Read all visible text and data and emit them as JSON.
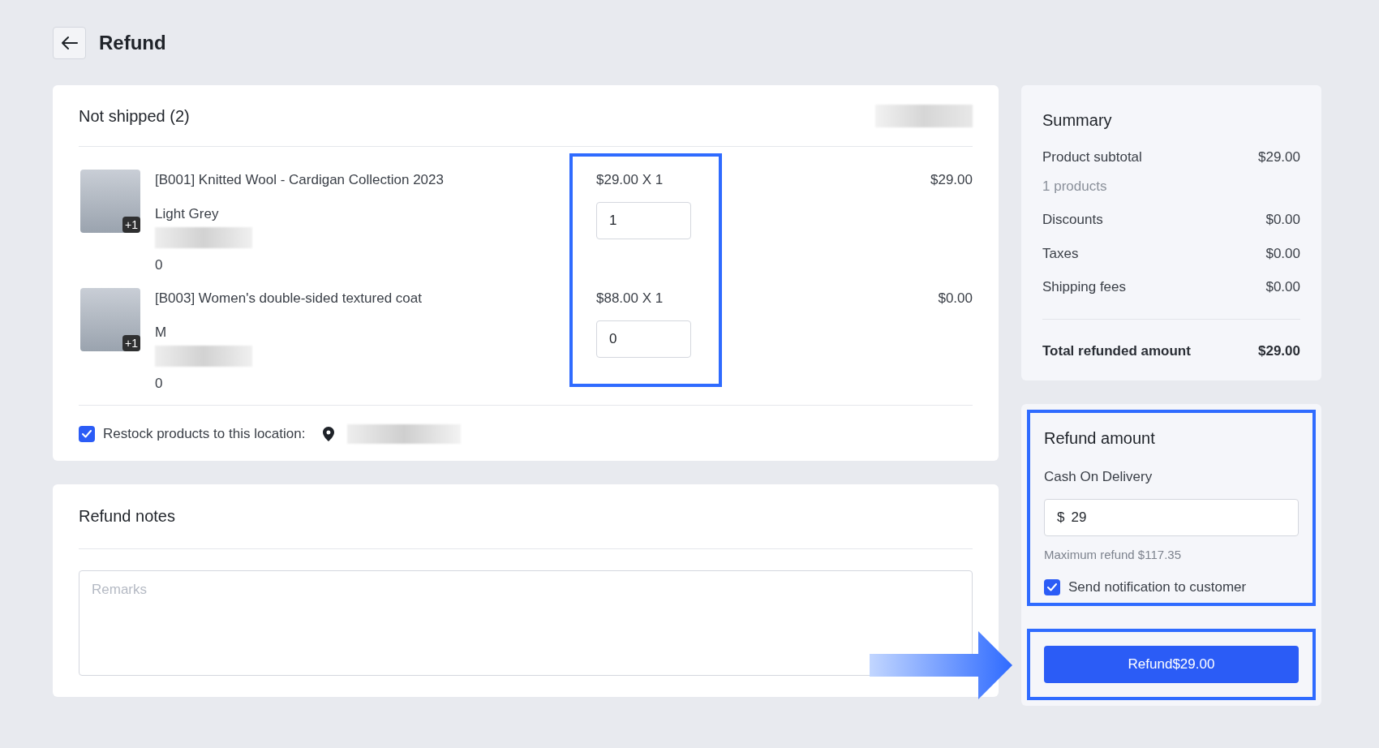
{
  "page": {
    "title": "Refund"
  },
  "shipment": {
    "title": "Not shipped (2)",
    "items": [
      {
        "name": "[B001] Knitted Wool - Cardigan Collection 2023",
        "variant": "Light Grey",
        "count": "0",
        "image_badge": "+1",
        "unit_price": "$29.00 X 1",
        "quantity": "1",
        "total": "$29.00"
      },
      {
        "name": "[B003] Women's double-sided textured coat",
        "variant": "M",
        "count": "0",
        "image_badge": "+1",
        "unit_price": "$88.00 X 1",
        "quantity": "0",
        "total": "$0.00"
      }
    ],
    "restock": {
      "label": "Restock products to this location:",
      "checked": true
    }
  },
  "notes": {
    "title": "Refund notes",
    "placeholder": "Remarks"
  },
  "summary": {
    "title": "Summary",
    "rows": [
      {
        "label": "Product subtotal",
        "value": "$29.00",
        "note": "1 products"
      },
      {
        "label": "Discounts",
        "value": "$0.00"
      },
      {
        "label": "Taxes",
        "value": "$0.00"
      },
      {
        "label": "Shipping fees",
        "value": "$0.00"
      }
    ],
    "total": {
      "label": "Total refunded amount",
      "value": "$29.00"
    }
  },
  "refund": {
    "title": "Refund amount",
    "method": "Cash On Delivery",
    "currency": "$",
    "amount": "29",
    "hint": "Maximum refund $117.35",
    "notify": {
      "label": "Send notification to customer",
      "checked": true
    },
    "button": "Refund$29.00"
  }
}
